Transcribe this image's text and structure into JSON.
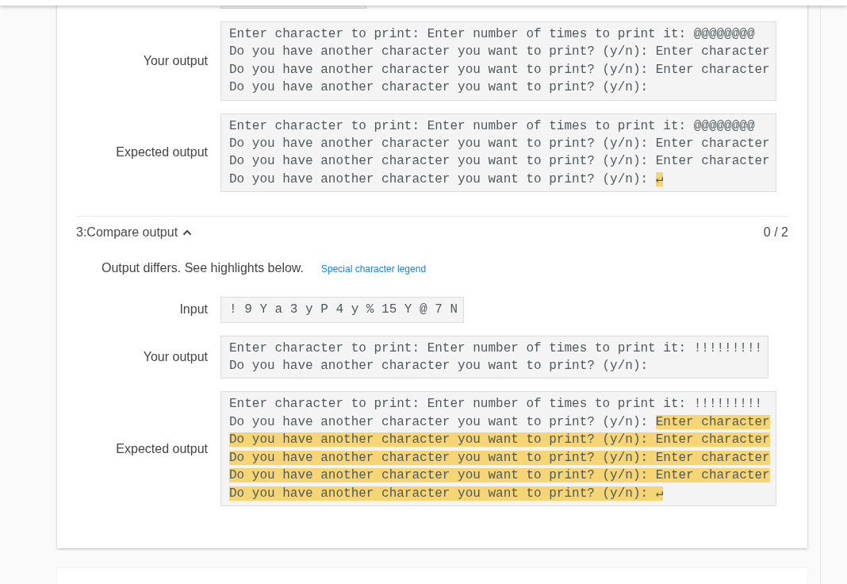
{
  "tests": [
    {
      "rows": [
        {
          "kind": "clipped"
        },
        {
          "kind": "output",
          "label": "Your output",
          "lines": [
            {
              "segments": [
                {
                  "text": "Enter character to print: Enter number of times to print it: @@@@@@@@",
                  "highlighted": false
                }
              ]
            },
            {
              "segments": [
                {
                  "text": "Do you have another character you want to print? (y/n): Enter character",
                  "highlighted": false
                }
              ]
            },
            {
              "segments": [
                {
                  "text": "Do you have another character you want to print? (y/n): Enter character",
                  "highlighted": false
                }
              ]
            },
            {
              "segments": [
                {
                  "text": "Do you have another character you want to print? (y/n):",
                  "highlighted": false
                }
              ]
            }
          ]
        },
        {
          "kind": "output",
          "label": "Expected output",
          "lines": [
            {
              "segments": [
                {
                  "text": "Enter character to print: Enter number of times to print it: @@@@@@@@",
                  "highlighted": false
                }
              ]
            },
            {
              "segments": [
                {
                  "text": "Do you have another character you want to print? (y/n): Enter character",
                  "highlighted": false
                }
              ]
            },
            {
              "segments": [
                {
                  "text": "Do you have another character you want to print? (y/n): Enter character",
                  "highlighted": false
                }
              ]
            },
            {
              "segments": [
                {
                  "text": "Do you have another character you want to print? (y/n): ",
                  "highlighted": false
                },
                {
                  "text": "↵",
                  "highlighted": true
                }
              ]
            }
          ]
        }
      ]
    },
    {
      "title": "3:Compare output",
      "expanded": true,
      "score": "0 / 2",
      "message": "Output differs. See highlights below.",
      "legend_link": "Special character legend",
      "rows": [
        {
          "kind": "input",
          "label": "Input",
          "value": "! 9 Y a 3 y P 4 y % 15 Y @ 7 N"
        },
        {
          "kind": "output",
          "label": "Your output",
          "lines": [
            {
              "segments": [
                {
                  "text": "Enter character to print: Enter number of times to print it: !!!!!!!!!",
                  "highlighted": false
                }
              ]
            },
            {
              "segments": [
                {
                  "text": "Do you have another character you want to print? (y/n):",
                  "highlighted": false
                }
              ]
            }
          ]
        },
        {
          "kind": "output",
          "label": "Expected output",
          "lines": [
            {
              "segments": [
                {
                  "text": "Enter character to print: Enter number of times to print it: !!!!!!!!!",
                  "highlighted": false
                }
              ]
            },
            {
              "segments": [
                {
                  "text": "Do you have another character you want to print? (y/n): ",
                  "highlighted": false
                },
                {
                  "text": "Enter character",
                  "highlighted": true
                }
              ]
            },
            {
              "segments": [
                {
                  "text": "Do you have another character you want to print? (y/n): Enter character",
                  "highlighted": true
                }
              ]
            },
            {
              "segments": [
                {
                  "text": "Do you have another character you want to print? (y/n): Enter character",
                  "highlighted": true
                }
              ]
            },
            {
              "segments": [
                {
                  "text": "Do you have another character you want to print? (y/n): Enter character",
                  "highlighted": true
                }
              ]
            },
            {
              "segments": [
                {
                  "text": "Do you have another character you want to print? (y/n): ↵",
                  "highlighted": true
                }
              ]
            }
          ]
        }
      ]
    }
  ]
}
